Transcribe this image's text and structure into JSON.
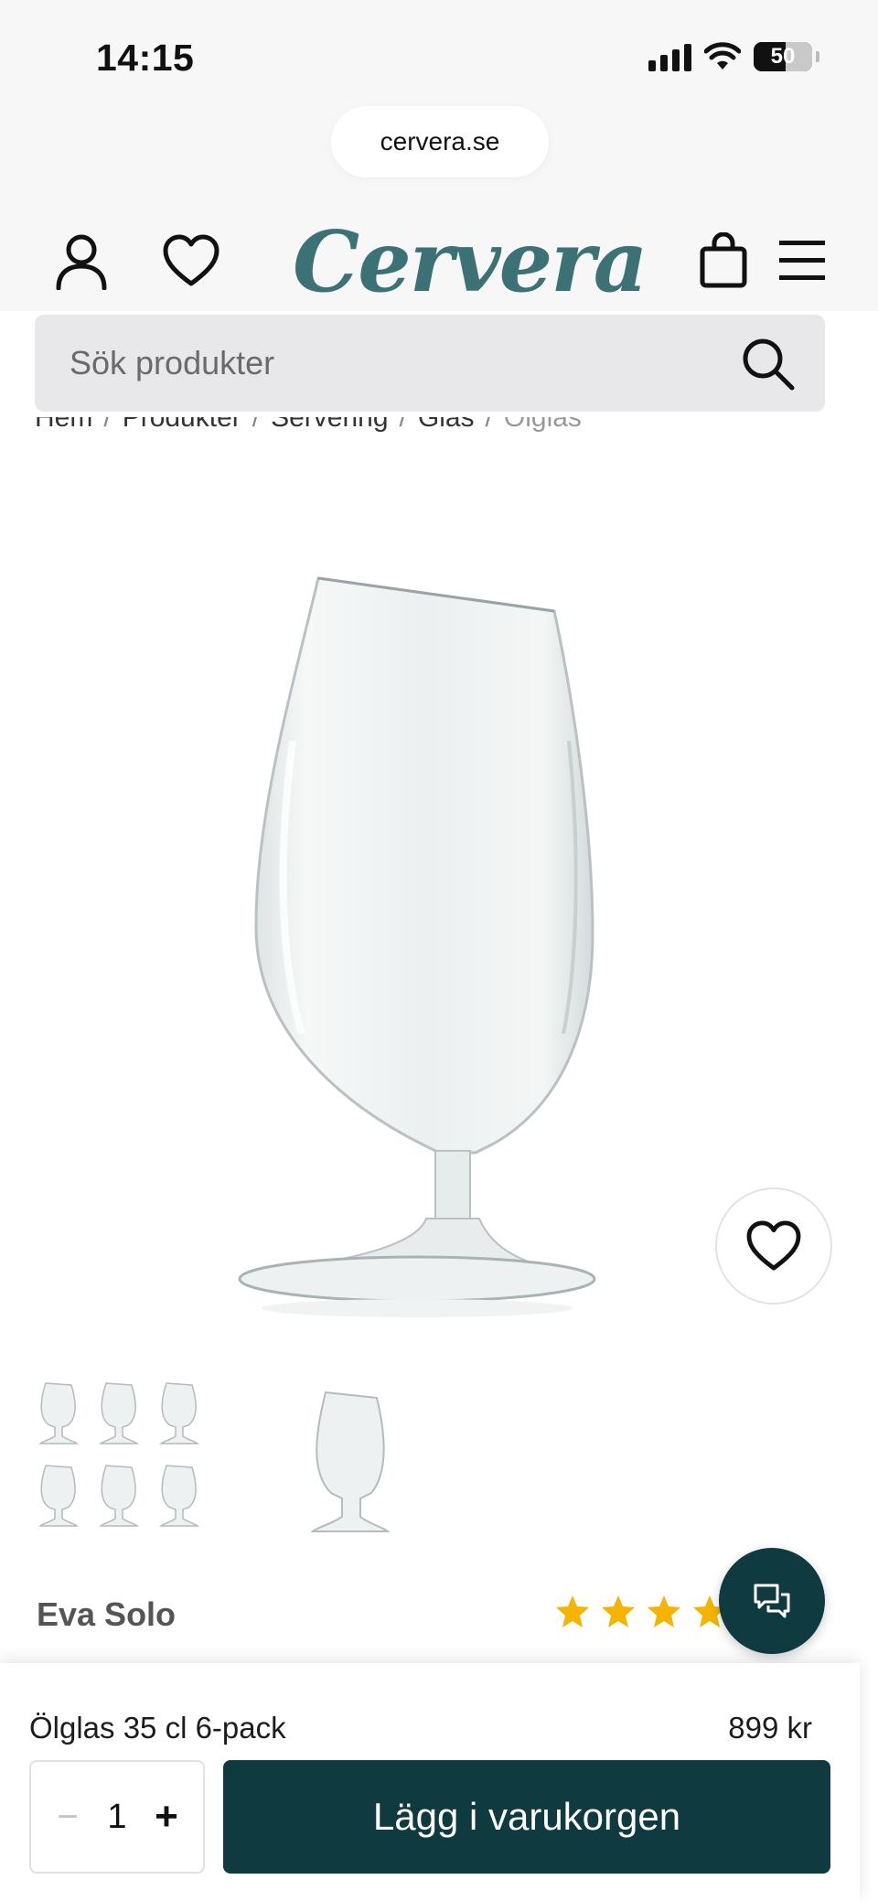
{
  "status_bar": {
    "time": "14:15",
    "battery": "50"
  },
  "browser": {
    "url": "cervera.se"
  },
  "header": {
    "logo": "Cervera"
  },
  "search": {
    "placeholder": "Sök produkter"
  },
  "breadcrumb": [
    "Hem",
    "Produkter",
    "Servering",
    "Glas",
    "Ölglas"
  ],
  "product": {
    "brand": "Eva Solo",
    "rating_stars_visible": 4,
    "name": "Ölglas 35 cl 6-pack",
    "price": "899 kr",
    "quantity": "1"
  },
  "actions": {
    "add_to_cart": "Lägg i varukorgen",
    "qty_minus": "−",
    "qty_plus": "+"
  },
  "colors": {
    "brand_teal": "#3c7276",
    "dark_teal": "#0e3a40",
    "star": "#f4b400"
  },
  "icons": [
    "user-icon",
    "heart-icon",
    "bag-icon",
    "menu-icon",
    "search-icon",
    "chat-icon",
    "star-icon"
  ]
}
